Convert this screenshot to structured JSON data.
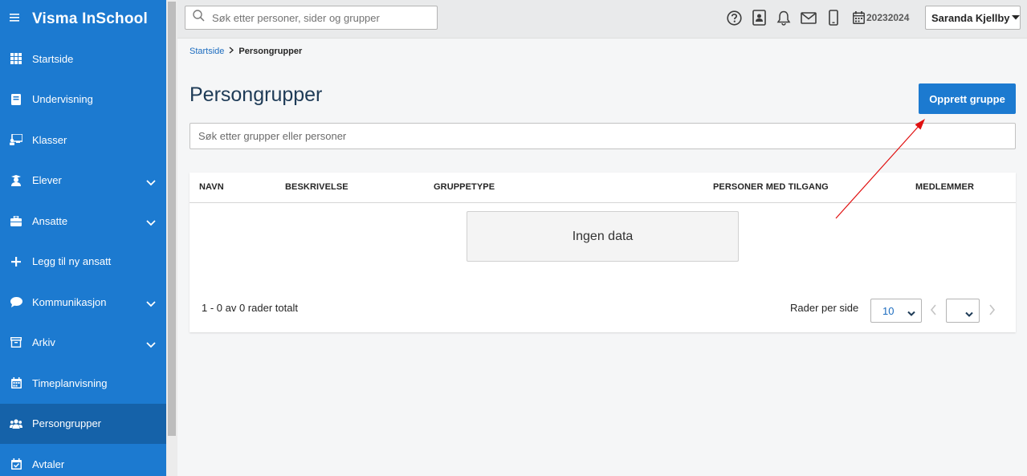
{
  "app": {
    "title": "Visma InSchool"
  },
  "sidebar": {
    "items": [
      {
        "label": "Startside",
        "icon": "grid-icon",
        "expandable": false
      },
      {
        "label": "Undervisning",
        "icon": "book-icon",
        "expandable": false
      },
      {
        "label": "Klasser",
        "icon": "classroom-icon",
        "expandable": false
      },
      {
        "label": "Elever",
        "icon": "student-icon",
        "expandable": true
      },
      {
        "label": "Ansatte",
        "icon": "briefcase-icon",
        "expandable": true
      },
      {
        "label": "Legg til ny ansatt",
        "icon": "plus-icon",
        "expandable": false
      },
      {
        "label": "Kommunikasjon",
        "icon": "chat-icon",
        "expandable": true
      },
      {
        "label": "Arkiv",
        "icon": "archive-icon",
        "expandable": true
      },
      {
        "label": "Timeplanvisning",
        "icon": "calendar-icon",
        "expandable": false
      },
      {
        "label": "Persongrupper",
        "icon": "people-icon",
        "expandable": false,
        "active": true
      },
      {
        "label": "Avtaler",
        "icon": "calendar-check-icon",
        "expandable": false
      }
    ]
  },
  "topbar": {
    "search_placeholder": "Søk etter personer, sider og grupper",
    "icons": [
      "help-icon",
      "contact-card-icon",
      "bell-icon",
      "mail-icon",
      "phone-icon",
      "calendar-icon"
    ],
    "school_year": "20232024",
    "user_name": "Saranda Kjellby"
  },
  "breadcrumb": {
    "home": "Startside",
    "current": "Persongrupper"
  },
  "page": {
    "title": "Persongrupper",
    "create_button": "Opprett gruppe",
    "search_placeholder": "Søk etter grupper eller personer"
  },
  "table": {
    "columns": [
      "NAVN",
      "BESKRIVELSE",
      "GRUPPETYPE",
      "PERSONER MED TILGANG",
      "MEDLEMMER"
    ],
    "empty_text": "Ingen data",
    "rows_total": "1 - 0 av 0 rader totalt",
    "rows_per_page_label": "Rader per side",
    "rows_per_page_value": "10",
    "page_value": ""
  },
  "colors": {
    "sidebar": "#1c7ad0",
    "sidebar_active": "#1562a9",
    "primary_button": "#1c7ad0",
    "title": "#1e3b57",
    "annotation_arrow": "#e01010"
  }
}
